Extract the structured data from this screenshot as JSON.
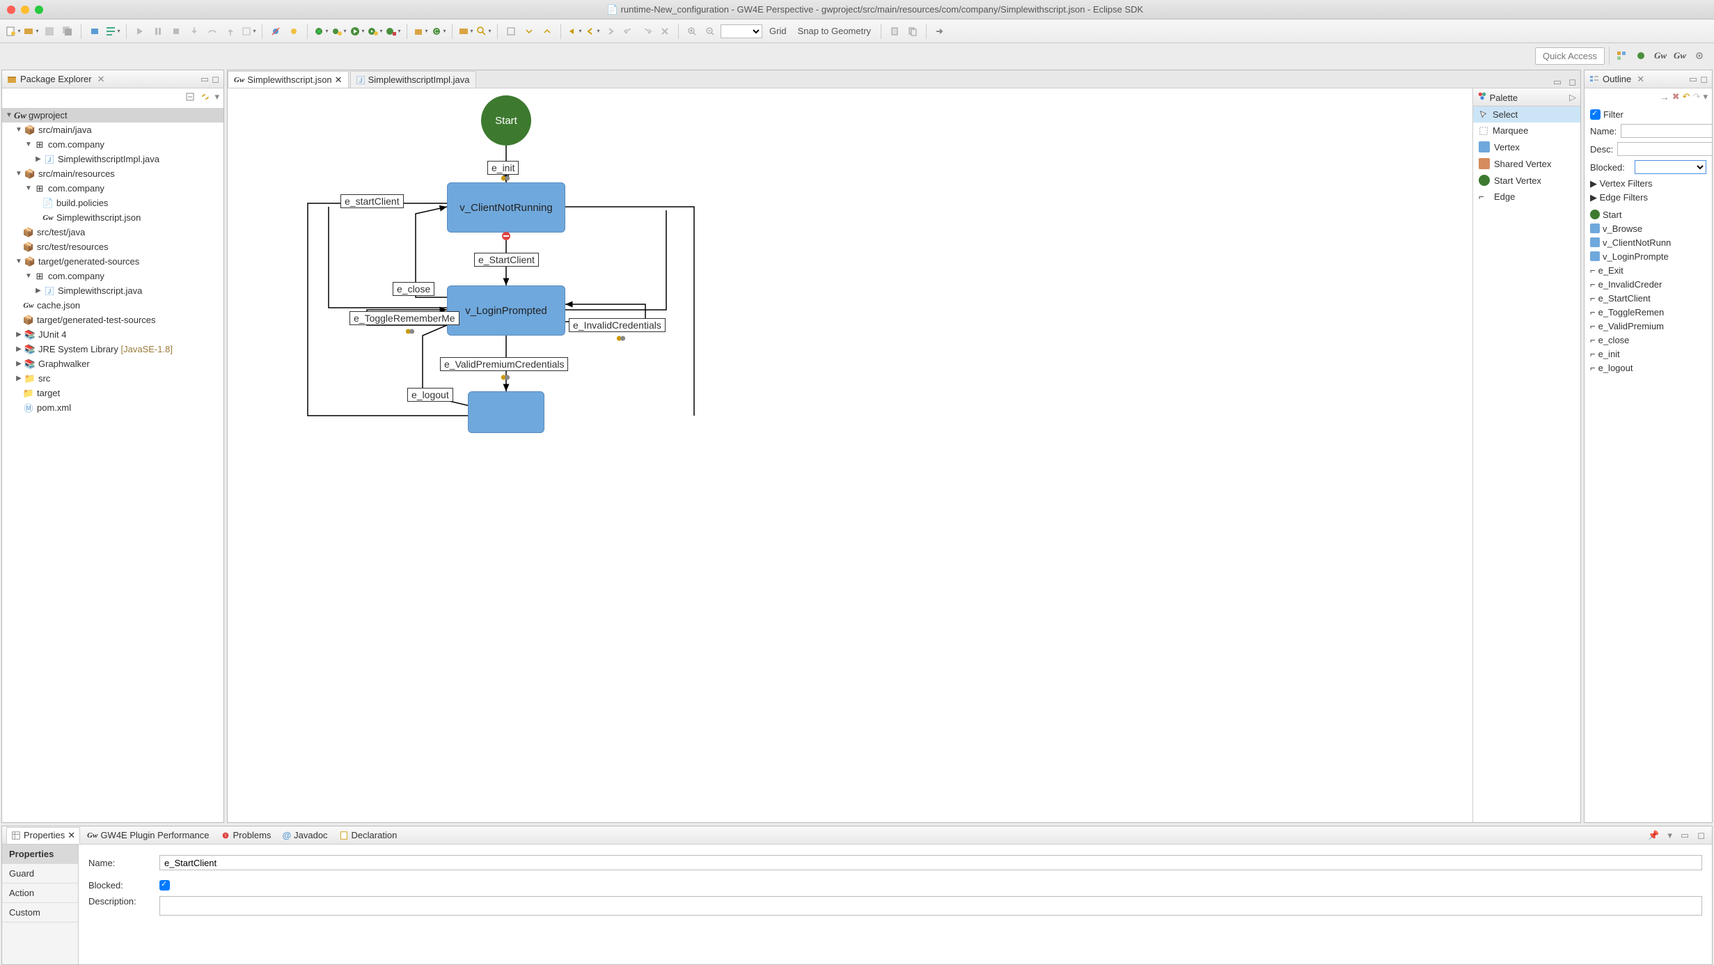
{
  "window": {
    "title": "runtime-New_configuration - GW4E Perspective - gwproject/src/main/resources/com/company/Simplewithscript.json - Eclipse SDK"
  },
  "toolbar_labels": {
    "grid": "Grid",
    "snap": "Snap to Geometry"
  },
  "quick_access": "Quick Access",
  "package_explorer": {
    "title": "Package Explorer",
    "project": "gwproject",
    "items": {
      "src_main_java": "src/main/java",
      "com_company": "com.company",
      "simple_impl_java": "SimplewithscriptImpl.java",
      "src_main_resources": "src/main/resources",
      "build_policies": "build.policies",
      "simple_json": "Simplewithscript.json",
      "src_test_java": "src/test/java",
      "src_test_resources": "src/test/resources",
      "target_gen_sources": "target/generated-sources",
      "simple_java": "Simplewithscript.java",
      "cache_json": "cache.json",
      "target_gen_test": "target/generated-test-sources",
      "junit": "JUnit 4",
      "jre": "JRE System Library",
      "jre_ver": "[JavaSE-1.8]",
      "graphwalker": "Graphwalker",
      "src": "src",
      "target": "target",
      "pom": "pom.xml"
    }
  },
  "editor": {
    "tab1": "Simplewithscript.json",
    "tab2": "SimplewithscriptImpl.java",
    "nodes": {
      "start": "Start",
      "v_client_not_running": "v_ClientNotRunning",
      "v_login_prompted": "v_LoginPrompted"
    },
    "edges": {
      "e_init": "e_init",
      "e_start_client_lower": "e_startClient",
      "e_start_client": "e_StartClient",
      "e_close": "e_close",
      "e_toggle": "e_ToggleRememberMe",
      "e_invalid": "e_InvalidCredentials",
      "e_valid_premium": "e_ValidPremiumCredentials",
      "e_logout": "e_logout"
    }
  },
  "palette": {
    "title": "Palette",
    "select": "Select",
    "marquee": "Marquee",
    "vertex": "Vertex",
    "shared_vertex": "Shared Vertex",
    "start_vertex": "Start Vertex",
    "edge": "Edge"
  },
  "outline": {
    "title": "Outline",
    "filter": "Filter",
    "name": "Name:",
    "desc": "Desc:",
    "blocked": "Blocked:",
    "vertex_filters": "Vertex Filters",
    "edge_filters": "Edge Filters",
    "items": {
      "start": "Start",
      "v_browse": "v_Browse",
      "v_client_not_run": "v_ClientNotRunn",
      "v_login_prompte": "v_LoginPrompte",
      "e_exit": "e_Exit",
      "e_invalid_creder": "e_InvalidCreder",
      "e_start_client": "e_StartClient",
      "e_toggle_remen": "e_ToggleRemen",
      "e_valid_premium": "e_ValidPremium",
      "e_close": "e_close",
      "e_init": "e_init",
      "e_logout": "e_logout"
    }
  },
  "bottom_tabs": {
    "properties": "Properties",
    "gw4e": "GW4E Plugin Performance",
    "problems": "Problems",
    "javadoc": "Javadoc",
    "declaration": "Declaration"
  },
  "properties_panel": {
    "side": {
      "properties": "Properties",
      "guard": "Guard",
      "action": "Action",
      "custom": "Custom"
    },
    "name_label": "Name:",
    "name_value": "e_StartClient",
    "blocked_label": "Blocked:",
    "description_label": "Description:"
  }
}
